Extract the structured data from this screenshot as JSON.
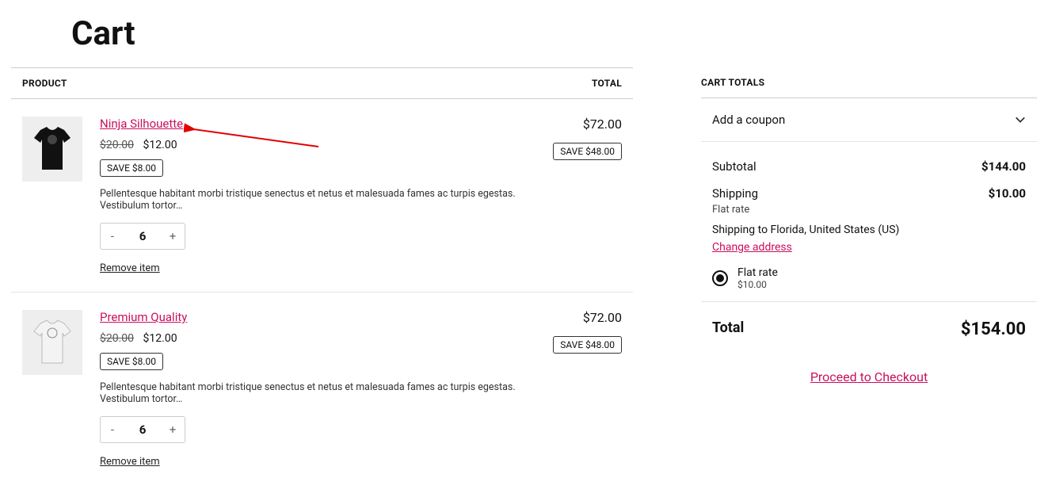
{
  "page_title": "Cart",
  "colors": {
    "accent": "#c9105f"
  },
  "table_headers": {
    "product": "PRODUCT",
    "total": "TOTAL"
  },
  "items": [
    {
      "name": "Ninja Silhouette",
      "orig_price": "$20.00",
      "sale_price": "$12.00",
      "unit_save": "SAVE $8.00",
      "line_total": "$72.00",
      "line_save": "SAVE $48.00",
      "description": "Pellentesque habitant morbi tristique senectus et netus et malesuada fames ac turpis egestas. Vestibulum tortor…",
      "qty": "6",
      "remove_label": "Remove item",
      "shirt_color": "#111"
    },
    {
      "name": "Premium Quality",
      "orig_price": "$20.00",
      "sale_price": "$12.00",
      "unit_save": "SAVE $8.00",
      "line_total": "$72.00",
      "line_save": "SAVE $48.00",
      "description": "Pellentesque habitant morbi tristique senectus et netus et malesuada fames ac turpis egestas. Vestibulum tortor…",
      "qty": "6",
      "remove_label": "Remove item",
      "shirt_color": "#f3f3f3"
    }
  ],
  "totals_panel": {
    "header": "CART TOTALS",
    "coupon_label": "Add a coupon",
    "subtotal_label": "Subtotal",
    "subtotal_value": "$144.00",
    "shipping_label": "Shipping",
    "shipping_value": "$10.00",
    "shipping_sub": "Flat rate",
    "shipping_to": "Shipping to Florida, United States (US)",
    "change_address": "Change address",
    "shipping_option": {
      "label": "Flat rate",
      "price": "$10.00",
      "selected": true
    },
    "total_label": "Total",
    "total_value": "$154.00",
    "checkout_label": "Proceed to Checkout"
  },
  "qty_controls": {
    "minus": "-",
    "plus": "+"
  }
}
